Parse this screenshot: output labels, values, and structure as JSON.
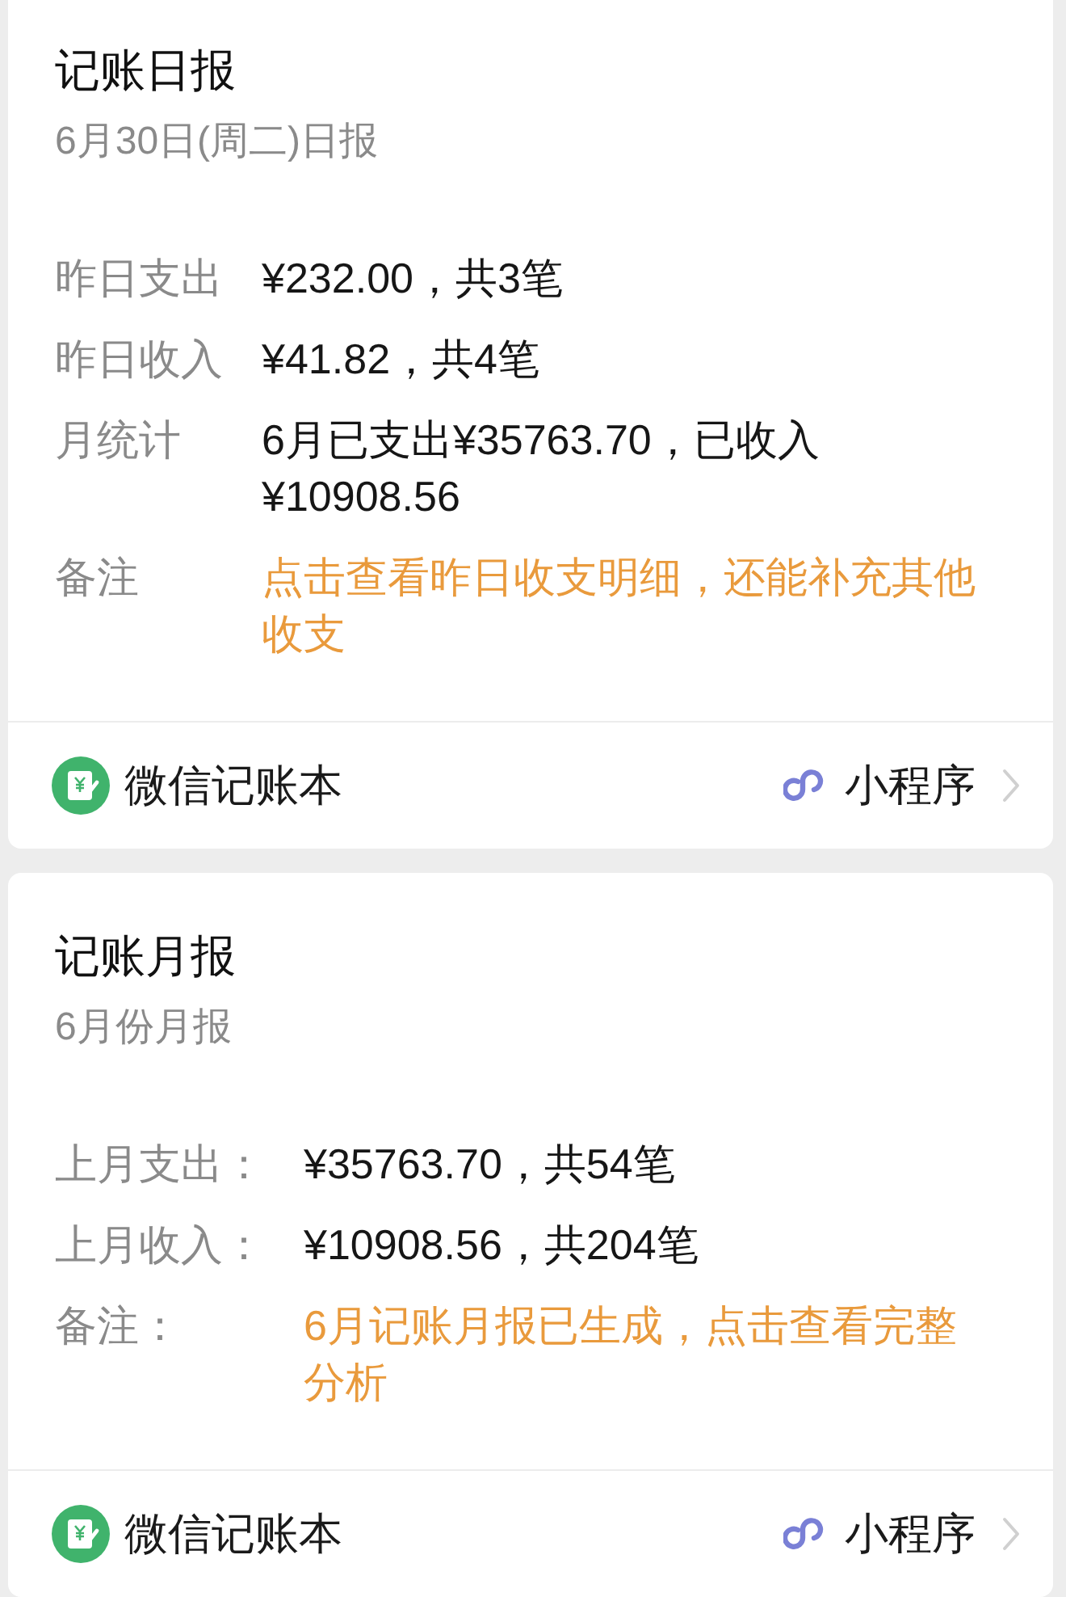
{
  "cards": [
    {
      "title": "记账日报",
      "subtitle": "6月30日(周二)日报",
      "rows": [
        {
          "label": "昨日支出",
          "value": "¥232.00，共3笔",
          "kind": "plain"
        },
        {
          "label": "昨日收入",
          "value": "¥41.82，共4笔",
          "kind": "plain"
        },
        {
          "label": "月统计",
          "value": "6月已支出¥35763.70，已收入¥10908.56",
          "kind": "plain"
        },
        {
          "label": "备注",
          "value": "点击查看昨日收支明细，还能补充其他收支",
          "kind": "link"
        }
      ],
      "footer": {
        "app_name": "微信记账本",
        "tag": "小程序"
      }
    },
    {
      "title": "记账月报",
      "subtitle": "6月份月报",
      "rows": [
        {
          "label": "上月支出：",
          "value": "¥35763.70，共54笔",
          "kind": "plain"
        },
        {
          "label": "上月收入：",
          "value": "¥10908.56，共204笔",
          "kind": "plain"
        },
        {
          "label": "备注：",
          "value": "6月记账月报已生成，点击查看完整分析",
          "kind": "link"
        }
      ],
      "footer": {
        "app_name": "微信记账本",
        "tag": "小程序"
      }
    }
  ]
}
